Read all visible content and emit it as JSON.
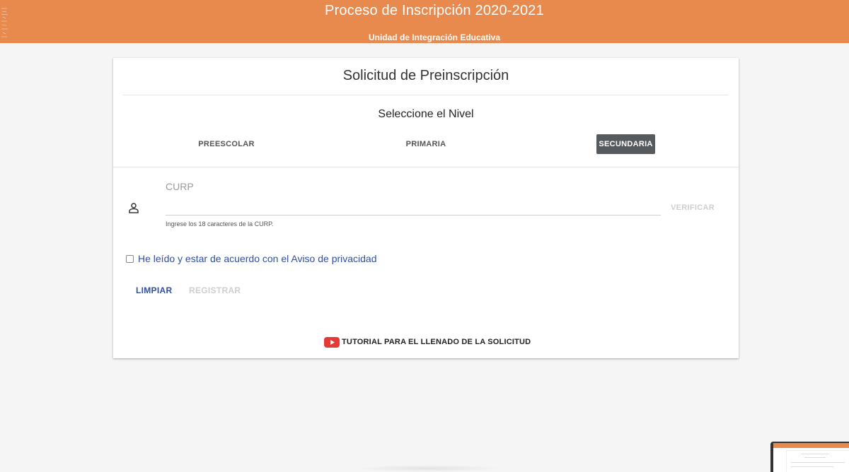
{
  "header": {
    "title": "Proceso de Inscripción 2020-2021",
    "subtitle": "Unidad de Integración Educativa",
    "background_color": "#e8894d"
  },
  "card": {
    "title": "Solicitud de Preinscripción",
    "level_title": "Seleccione el Nivel",
    "levels": [
      {
        "label": "PREESCOLAR",
        "selected": false
      },
      {
        "label": "PRIMARIA",
        "selected": false
      },
      {
        "label": "SECUNDARIA",
        "selected": true
      }
    ],
    "curp": {
      "icon": "person-icon",
      "label": "CURP",
      "value": "",
      "hint": "Ingrese los 18 caracteres de la CURP.",
      "verify_label": "VERIFICAR"
    },
    "privacy": {
      "checked": false,
      "label": "He leído y estar de acuerdo con el Aviso de privacidad"
    },
    "actions": {
      "clear_label": "LIMPIAR",
      "register_label": "REGISTRAR"
    },
    "tutorial": {
      "icon": "youtube-icon",
      "label": "TUTORIAL PARA EL LLENADO DE LA SOLICITUD"
    }
  },
  "colors": {
    "accent": "#e8894d",
    "link": "#2f4f9f",
    "selected_level": "#555a5e",
    "disabled": "#cfcfcf"
  }
}
